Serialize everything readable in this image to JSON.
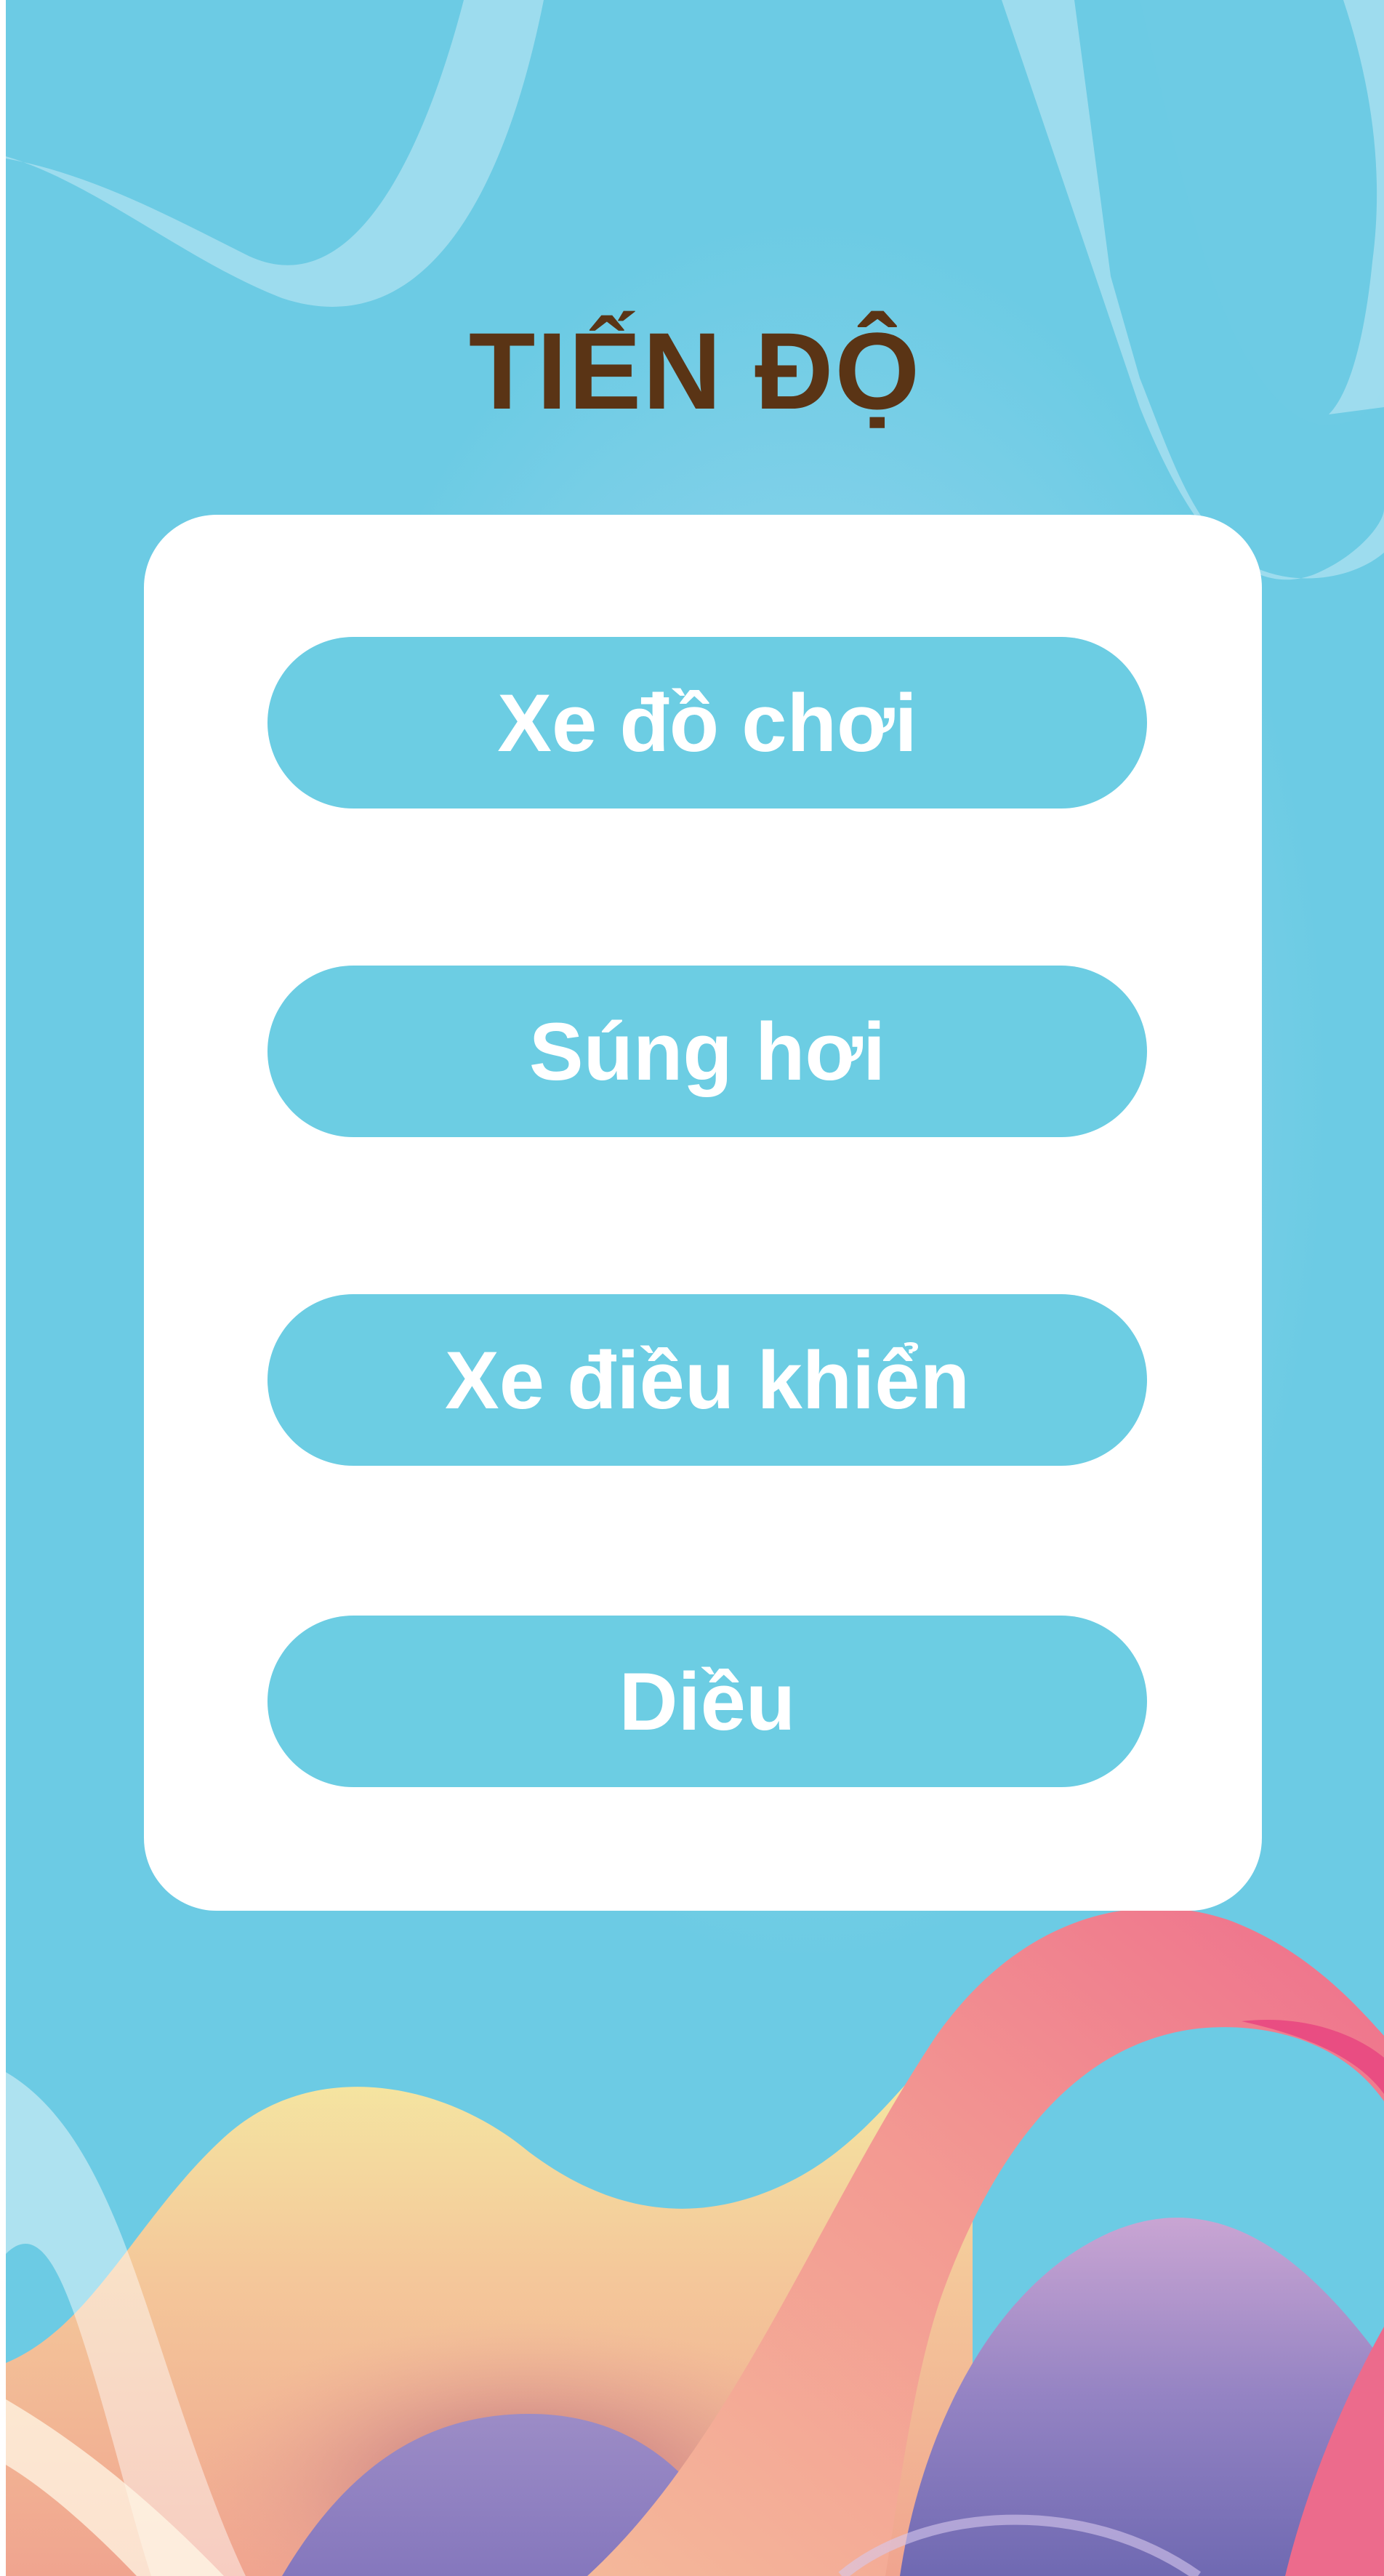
{
  "screen": {
    "title": "TIẾN ĐỘ"
  },
  "menu": {
    "items": [
      {
        "label": "Xe đồ chơi"
      },
      {
        "label": "Súng hơi"
      },
      {
        "label": "Xe điều khiển"
      },
      {
        "label": "Diều"
      }
    ]
  },
  "colors": {
    "background": "#6ccbe4",
    "title": "#5a3415",
    "card": "#ffffff",
    "button": "#6ccde3",
    "button_text": "#ffffff",
    "wave_yellow": "#f3eba4",
    "wave_pink": "#f07a8c",
    "wave_purple": "#8d7fc0"
  }
}
